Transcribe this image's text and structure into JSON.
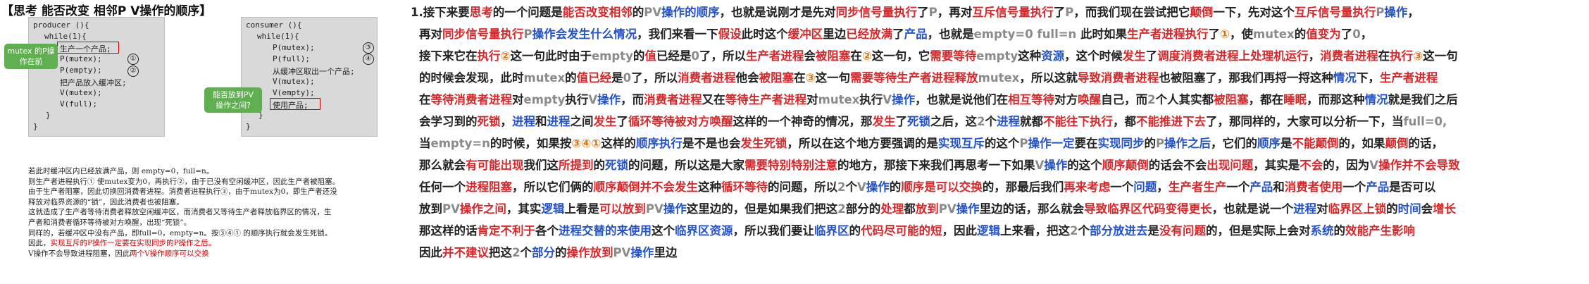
{
  "title": "【思考 能否改变 相邻P V操作的顺序】",
  "producer": {
    "lines": [
      "producer (){",
      "while(1){",
      "生产一个产品;",
      "P(mutex);",
      "P(empty);",
      "把产品放入缓冲区;",
      "V(mutex);",
      "V(full);",
      "}",
      "}"
    ],
    "marks": [
      "①",
      "②"
    ]
  },
  "consumer": {
    "lines": [
      "consumer (){",
      "while(1){",
      "P(mutex);",
      "P(full);",
      "从缓冲区取出一个产品;",
      "V(mutex);",
      "V(empty);",
      "使用产品;",
      "}",
      "}"
    ],
    "marks": [
      "③",
      "④"
    ]
  },
  "bubbles": {
    "left": "mutex 的P操\n作在前",
    "right": "能否放到PV\n操作之间?"
  },
  "notes": [
    "若此时缓冲区内已经放满产品，则 empty=0，full=n。",
    "则生产者进程执行① 使mutex变为0，再执行②，由于已没有空闲缓冲区，因此生产者被阻塞。",
    "由于生产者阻塞，因此切换回消费者进程。消费者进程执行③，由于mutex为0，即生产者还没",
    "释放对临界资源的“锁”，因此消费者也被阻塞。",
    "这就造成了生产者等待消费者释放空闲缓冲区，而消费者又等待生产者释放临界区的情况，生",
    "产者和消费者循环等待被对方唤醒，出现“死锁”。",
    "同样的，若缓冲区中没有产品，即full=0，empty=n。按③④① 的顺序执行就会发生死锁。",
    "因此，",
    "实现互斥的P操作一定要在实现同步的P操作之后。",
    "V操作不会导致进程阻塞，因此",
    "两个V操作顺序可以交换"
  ],
  "paragraph": [
    [
      [
        "1.接下来要",
        ""
      ],
      [
        "思考",
        "r"
      ],
      [
        "的一个问题是",
        ""
      ],
      [
        "能否改变相邻",
        "r"
      ],
      [
        "的",
        ""
      ],
      [
        "PV",
        "g"
      ],
      [
        "操作的顺序",
        "b"
      ],
      [
        "，也就是说刚才是先对",
        ""
      ],
      [
        "同步信号量执行",
        "r"
      ],
      [
        "了",
        ""
      ],
      [
        "P",
        "g"
      ],
      [
        "，再对",
        ""
      ],
      [
        "互斥信号量执行",
        "r"
      ],
      [
        "了",
        ""
      ],
      [
        "P",
        "g"
      ],
      [
        "，而我们现在尝试把它",
        ""
      ],
      [
        "颠倒",
        "r"
      ],
      [
        "一下，先对这个",
        ""
      ],
      [
        "互斥信号量执行",
        "r"
      ],
      [
        "P",
        "g"
      ],
      [
        "操作",
        "b"
      ],
      [
        "，",
        ""
      ]
    ],
    [
      [
        "再对",
        ""
      ],
      [
        "同步信号量执行",
        "r"
      ],
      [
        "P",
        "g"
      ],
      [
        "操作会发生什么",
        "b"
      ],
      [
        "情况",
        "b"
      ],
      [
        "，我们来看一下",
        ""
      ],
      [
        "假设",
        "r"
      ],
      [
        "此时这个",
        ""
      ],
      [
        "缓冲区",
        "r"
      ],
      [
        "里边",
        ""
      ],
      [
        "已经放满",
        "r"
      ],
      [
        "了",
        ""
      ],
      [
        "产品",
        "b"
      ],
      [
        "，也就是",
        ""
      ],
      [
        "empty=0 full=n",
        "g"
      ],
      [
        " 此时如果",
        ""
      ],
      [
        "生产者进程执行",
        "r"
      ],
      [
        "了",
        ""
      ],
      [
        "①",
        "o"
      ],
      [
        "，使",
        ""
      ],
      [
        "mutex",
        "g"
      ],
      [
        "的",
        ""
      ],
      [
        "值变为",
        "r"
      ],
      [
        "了",
        ""
      ],
      [
        "0",
        "g"
      ],
      [
        "，",
        ""
      ]
    ],
    [
      [
        "接下来它在",
        ""
      ],
      [
        "执行",
        "r"
      ],
      [
        "②",
        "o"
      ],
      [
        "这一句此时由于",
        ""
      ],
      [
        "empty",
        "g"
      ],
      [
        "的",
        ""
      ],
      [
        "值",
        "r"
      ],
      [
        "已经是",
        ""
      ],
      [
        "0",
        "g"
      ],
      [
        "了，所以",
        ""
      ],
      [
        "生产者进程",
        "r"
      ],
      [
        "会",
        ""
      ],
      [
        "被阻塞",
        "r"
      ],
      [
        "在",
        ""
      ],
      [
        "②",
        "o"
      ],
      [
        "这一句，它",
        ""
      ],
      [
        "需要等待",
        "r"
      ],
      [
        "empty",
        "g"
      ],
      [
        "这种",
        ""
      ],
      [
        "资源",
        "b"
      ],
      [
        "，这个时候",
        ""
      ],
      [
        "发生",
        "r"
      ],
      [
        "了",
        ""
      ],
      [
        "调度消费者进程",
        "r"
      ],
      [
        "上处理机运行",
        "r"
      ],
      [
        "，",
        ""
      ],
      [
        "消费者进程",
        "r"
      ],
      [
        "在",
        ""
      ],
      [
        "执行",
        "r"
      ],
      [
        "③",
        "o"
      ],
      [
        "这一句",
        ""
      ]
    ],
    [
      [
        "的时候会发现，此时",
        ""
      ],
      [
        "mutex",
        "g"
      ],
      [
        "的",
        ""
      ],
      [
        "值已经",
        "r"
      ],
      [
        "是",
        ""
      ],
      [
        "0",
        "g"
      ],
      [
        "了，所以",
        ""
      ],
      [
        "消费者进程",
        "r"
      ],
      [
        "他会",
        ""
      ],
      [
        "被阻塞",
        "r"
      ],
      [
        "在",
        ""
      ],
      [
        "③",
        "o"
      ],
      [
        "这一句",
        ""
      ],
      [
        "需要等待生产者进程释放",
        "r"
      ],
      [
        "mutex",
        "g"
      ],
      [
        "，所以这就",
        ""
      ],
      [
        "导致消费者进程",
        "r"
      ],
      [
        "也被阻塞了，那我们再捋一捋这种",
        ""
      ],
      [
        "情况",
        "b"
      ],
      [
        "下，",
        ""
      ],
      [
        "生产者进程",
        "r"
      ]
    ],
    [
      [
        "在",
        ""
      ],
      [
        "等待消费者进程",
        "r"
      ],
      [
        "对",
        ""
      ],
      [
        "empty",
        "g"
      ],
      [
        "执行",
        ""
      ],
      [
        "V",
        "g"
      ],
      [
        "操作",
        "b"
      ],
      [
        "，而",
        ""
      ],
      [
        "消费者进程",
        "r"
      ],
      [
        "又在",
        ""
      ],
      [
        "等待生产者进程",
        "r"
      ],
      [
        "对",
        ""
      ],
      [
        "mutex",
        "g"
      ],
      [
        "执行",
        ""
      ],
      [
        "V",
        "g"
      ],
      [
        "操作",
        "b"
      ],
      [
        "，也就是说他们在",
        ""
      ],
      [
        "相互等待",
        "r"
      ],
      [
        "对方",
        ""
      ],
      [
        "唤醒",
        "r"
      ],
      [
        "自己，而",
        ""
      ],
      [
        "2",
        "g"
      ],
      [
        "个人其实都",
        ""
      ],
      [
        "被阻塞",
        "r"
      ],
      [
        "，都在",
        ""
      ],
      [
        "睡眠",
        "r"
      ],
      [
        "，而那这种",
        ""
      ],
      [
        "情况",
        "b"
      ],
      [
        "就是我们之后",
        ""
      ]
    ],
    [
      [
        "会学习到的",
        ""
      ],
      [
        "死锁",
        "r"
      ],
      [
        "，",
        ""
      ],
      [
        "进程",
        "b"
      ],
      [
        "和",
        ""
      ],
      [
        "进程",
        "b"
      ],
      [
        "之间",
        ""
      ],
      [
        "发生",
        "r"
      ],
      [
        "了",
        ""
      ],
      [
        "循环等待被对方唤醒",
        "r"
      ],
      [
        "这样的一个神奇的情况，那",
        ""
      ],
      [
        "发生",
        "r"
      ],
      [
        "了",
        ""
      ],
      [
        "死锁",
        "b"
      ],
      [
        "之后，这",
        ""
      ],
      [
        "2",
        "g"
      ],
      [
        "个",
        ""
      ],
      [
        "进程",
        "b"
      ],
      [
        "就都",
        ""
      ],
      [
        "不能往下执行",
        "r"
      ],
      [
        "，都",
        ""
      ],
      [
        "不能推进下去",
        "r"
      ],
      [
        "了，那同样的，大家可以分析一下，当",
        ""
      ],
      [
        "full=0,",
        "g"
      ]
    ],
    [
      [
        "当",
        ""
      ],
      [
        "empty=n",
        "g"
      ],
      [
        "的时候，如果按",
        ""
      ],
      [
        "③④①",
        "o"
      ],
      [
        "这样的",
        ""
      ],
      [
        "顺序执行",
        "b"
      ],
      [
        "是不是也会",
        ""
      ],
      [
        "发生死锁",
        "r"
      ],
      [
        "，所以在这个地方要强调的是",
        ""
      ],
      [
        "实现互斥",
        "b"
      ],
      [
        "的这个",
        ""
      ],
      [
        "P",
        "g"
      ],
      [
        "操作一定",
        "b"
      ],
      [
        "要在",
        ""
      ],
      [
        "实现同步",
        "b"
      ],
      [
        "的",
        ""
      ],
      [
        "P",
        "g"
      ],
      [
        "操作之后",
        "b"
      ],
      [
        "，它们的",
        ""
      ],
      [
        "顺序",
        "b"
      ],
      [
        "是",
        ""
      ],
      [
        "不能颠倒",
        "r"
      ],
      [
        "的，如果",
        ""
      ],
      [
        "颠倒",
        "r"
      ],
      [
        "的话，",
        ""
      ]
    ],
    [
      [
        "那么就会",
        ""
      ],
      [
        "有可能出现",
        "r"
      ],
      [
        "我们这",
        ""
      ],
      [
        "所提到",
        "r"
      ],
      [
        "的",
        ""
      ],
      [
        "死锁",
        "b"
      ],
      [
        "的问题，所以这是大家",
        ""
      ],
      [
        "需要特别特别注意",
        "r"
      ],
      [
        "的地方，那接下来我们再思考一下如果",
        ""
      ],
      [
        "V",
        "g"
      ],
      [
        "操作",
        "b"
      ],
      [
        "的这个",
        ""
      ],
      [
        "顺序颠倒",
        "r"
      ],
      [
        "的话会不会",
        ""
      ],
      [
        "出现问题",
        "r"
      ],
      [
        "，其实是",
        ""
      ],
      [
        "不会",
        "r"
      ],
      [
        "的，因为",
        ""
      ],
      [
        "V",
        "g"
      ],
      [
        "操作并不会导致",
        "r"
      ]
    ],
    [
      [
        "任何一个",
        ""
      ],
      [
        "进程阻塞",
        "r"
      ],
      [
        "，所以它们俩的",
        ""
      ],
      [
        "顺序颠倒并不会发生",
        "r"
      ],
      [
        "这种",
        ""
      ],
      [
        "循环等待",
        "r"
      ],
      [
        "的问题，所以",
        ""
      ],
      [
        "2",
        "g"
      ],
      [
        "个",
        ""
      ],
      [
        "V",
        "g"
      ],
      [
        "操作",
        "b"
      ],
      [
        "的",
        ""
      ],
      [
        "顺序是可以交换",
        "r"
      ],
      [
        "的，那最后我们",
        ""
      ],
      [
        "再来考虑",
        "r"
      ],
      [
        "一个",
        ""
      ],
      [
        "问题",
        "b"
      ],
      [
        "，",
        ""
      ],
      [
        "生产者生产",
        "r"
      ],
      [
        "一个",
        ""
      ],
      [
        "产品",
        "b"
      ],
      [
        "和",
        ""
      ],
      [
        "消费者使用",
        "r"
      ],
      [
        "一个",
        ""
      ],
      [
        "产品",
        "b"
      ],
      [
        "是否可以",
        ""
      ]
    ],
    [
      [
        "放到",
        ""
      ],
      [
        "PV",
        "g"
      ],
      [
        "操作之间",
        "r"
      ],
      [
        "，其实",
        ""
      ],
      [
        "逻辑",
        "b"
      ],
      [
        "上看是",
        ""
      ],
      [
        "可以放到",
        "r"
      ],
      [
        "PV",
        "g"
      ],
      [
        "操作",
        "b"
      ],
      [
        "这里边的，但是如果我们把这",
        ""
      ],
      [
        "2",
        "g"
      ],
      [
        "部分的",
        ""
      ],
      [
        "处理",
        "r"
      ],
      [
        "都",
        ""
      ],
      [
        "放到",
        "r"
      ],
      [
        "PV",
        "g"
      ],
      [
        "操作",
        "b"
      ],
      [
        "里边的话，那么就会",
        ""
      ],
      [
        "导致临界区代码变得更长",
        "r"
      ],
      [
        "，也就是说一个",
        ""
      ],
      [
        "进程",
        "b"
      ],
      [
        "对",
        ""
      ],
      [
        "临界区上锁",
        "r"
      ],
      [
        "的",
        ""
      ],
      [
        "时间",
        "b"
      ],
      [
        "会",
        ""
      ],
      [
        "增长",
        "r"
      ]
    ],
    [
      [
        "那这样的话",
        ""
      ],
      [
        "肯定不利于",
        "r"
      ],
      [
        "各个",
        ""
      ],
      [
        "进程交替的来使用",
        "b"
      ],
      [
        "这个",
        ""
      ],
      [
        "临界区资源",
        "b"
      ],
      [
        "，所以我们要让",
        ""
      ],
      [
        "临界区",
        "b"
      ],
      [
        "的",
        ""
      ],
      [
        "代码尽可能的短",
        "r"
      ],
      [
        "，因此",
        ""
      ],
      [
        "逻辑",
        "b"
      ],
      [
        "上来看，把这",
        ""
      ],
      [
        "2",
        "g"
      ],
      [
        "个",
        ""
      ],
      [
        "部分放进去",
        "b"
      ],
      [
        "是",
        ""
      ],
      [
        "没有问题",
        "r"
      ],
      [
        "的，但是实际上会对",
        ""
      ],
      [
        "系统",
        "b"
      ],
      [
        "的",
        ""
      ],
      [
        "效能产生影响",
        "r"
      ]
    ],
    [
      [
        "因此",
        ""
      ],
      [
        "并不建议",
        "r"
      ],
      [
        "把这",
        ""
      ],
      [
        "2",
        "g"
      ],
      [
        "个",
        ""
      ],
      [
        "部分",
        "b"
      ],
      [
        "的",
        ""
      ],
      [
        "操作放到",
        "r"
      ],
      [
        "PV",
        "g"
      ],
      [
        "操作",
        "b"
      ],
      [
        "里边",
        ""
      ]
    ]
  ]
}
